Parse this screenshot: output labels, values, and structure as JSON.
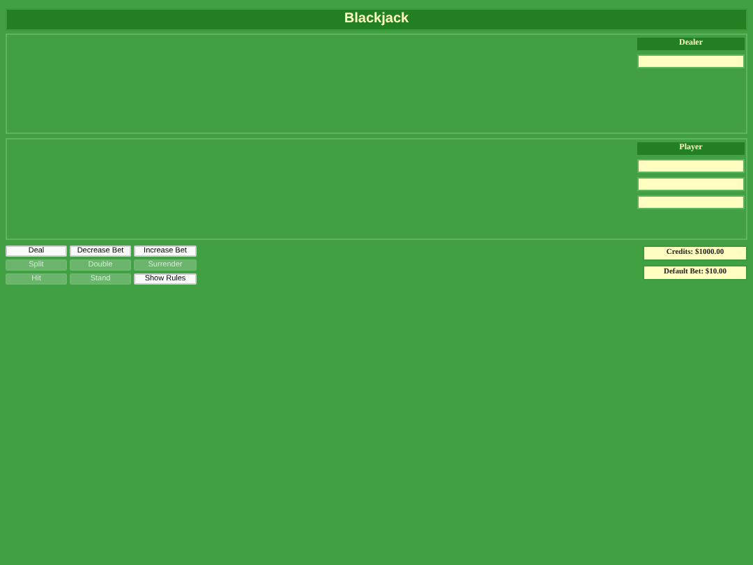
{
  "title": "Blackjack",
  "dealer": {
    "label": "Dealer",
    "boxes": [
      {
        "kind": "blank"
      }
    ]
  },
  "player": {
    "label": "Player",
    "boxes": [
      {
        "kind": "blank"
      },
      {
        "kind": "blank"
      },
      {
        "kind": "blank"
      }
    ]
  },
  "buttons": [
    {
      "label": "Deal",
      "disabled": false
    },
    {
      "label": "Decrease Bet",
      "disabled": false
    },
    {
      "label": "Increase Bet",
      "disabled": false
    },
    {
      "label": "Split",
      "disabled": true
    },
    {
      "label": "Double",
      "disabled": true
    },
    {
      "label": "Surrender",
      "disabled": true
    },
    {
      "label": "Hit",
      "disabled": true
    },
    {
      "label": "Stand",
      "disabled": true
    },
    {
      "label": "Show Rules",
      "disabled": false
    }
  ],
  "stats": [
    "Credits: $1000.00",
    "Default Bet: $10.00"
  ]
}
